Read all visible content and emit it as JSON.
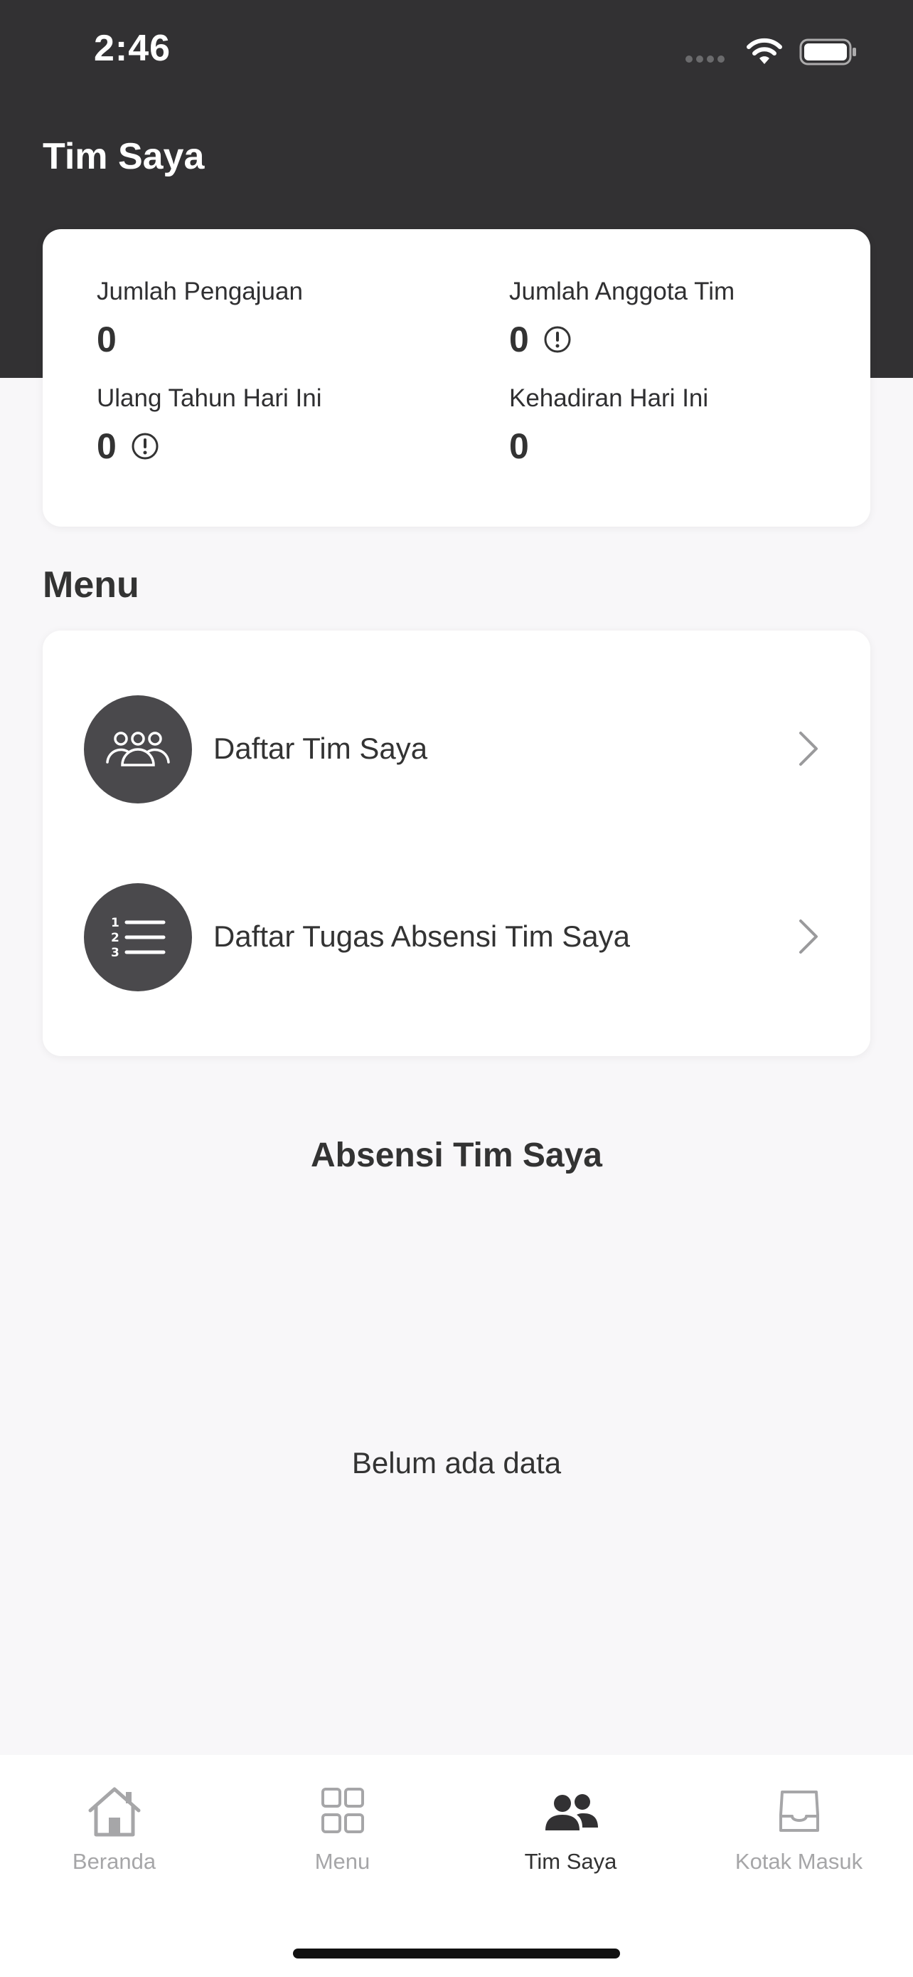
{
  "status_bar": {
    "time": "2:46",
    "icons": [
      "signal-icon",
      "wifi-icon",
      "battery-icon"
    ]
  },
  "header": {
    "title": "Tim Saya"
  },
  "stats": {
    "pengajuan": {
      "label": "Jumlah Pengajuan",
      "value": "0"
    },
    "anggota": {
      "label": "Jumlah Anggota Tim",
      "value": "0",
      "icon": "info-icon"
    },
    "ulang_tahun": {
      "label": "Ulang Tahun Hari Ini",
      "value": "0",
      "icon": "info-icon"
    },
    "kehadiran": {
      "label": "Kehadiran Hari Ini",
      "value": "0"
    }
  },
  "menu": {
    "title": "Menu",
    "items": [
      {
        "label": "Daftar Tim Saya",
        "icon": "team-icon"
      },
      {
        "label": "Daftar Tugas Absensi Tim Saya",
        "icon": "numbered-list-icon"
      }
    ]
  },
  "absensi": {
    "title": "Absensi Tim Saya",
    "empty_text": "Belum ada data"
  },
  "tab_bar": {
    "active": "Tim Saya",
    "tabs": [
      {
        "label": "Beranda",
        "icon": "home-icon"
      },
      {
        "label": "Menu",
        "icon": "grid-icon"
      },
      {
        "label": "Tim Saya",
        "icon": "people-icon"
      },
      {
        "label": "Kotak Masuk",
        "icon": "inbox-icon"
      }
    ]
  },
  "colors": {
    "header_bg": "#323133",
    "page_bg": "#f8f7f9",
    "avatar_bg": "#4a494c",
    "tab_inactive": "#a6a6a8",
    "tab_active": "#333333"
  }
}
